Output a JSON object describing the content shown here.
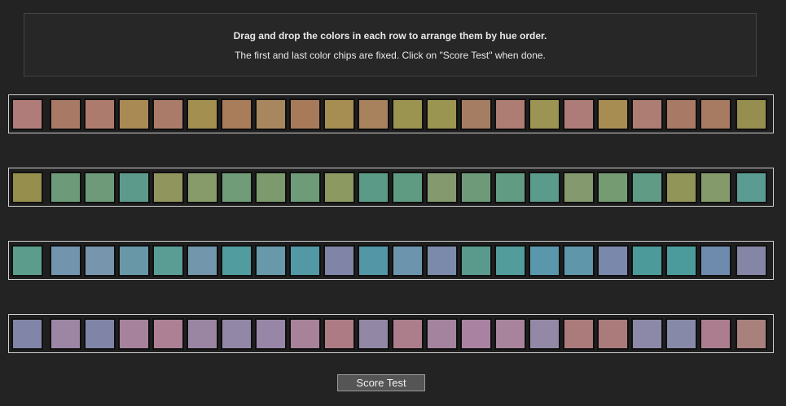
{
  "instructions": {
    "line1": "Drag and drop the colors in each row to arrange them by hue order.",
    "line2": "The first and last color chips are fixed. Click on \"Score Test\" when done."
  },
  "rows": [
    {
      "chips": [
        "#b07c7a",
        "#a87a66",
        "#ad7b6d",
        "#a98a55",
        "#ab7b69",
        "#a39050",
        "#a97c5a",
        "#a9875e",
        "#a77b5a",
        "#a68d52",
        "#a7825c",
        "#9b9450",
        "#9a9550",
        "#a57d62",
        "#ad7c72",
        "#9b9452",
        "#ae7c78",
        "#a88d52",
        "#ad7c72",
        "#a87965",
        "#a67b62",
        "#958e4e"
      ]
    },
    {
      "chips": [
        "#968e4d",
        "#6d9b79",
        "#6f9a79",
        "#5c9b8c",
        "#90955e",
        "#879a69",
        "#709c78",
        "#7c9a6d",
        "#6f9c78",
        "#8c9960",
        "#5c9a88",
        "#5f9a83",
        "#849a6e",
        "#6e9a79",
        "#629b84",
        "#5a9b8c",
        "#84996d",
        "#759b73",
        "#609b85",
        "#929558",
        "#859a6b",
        "#5a9b92"
      ]
    },
    {
      "chips": [
        "#5c9c8d",
        "#7394ad",
        "#7796ae",
        "#6898a8",
        "#5a9d94",
        "#7296ab",
        "#519c9e",
        "#6799aa",
        "#5398a5",
        "#8085a7",
        "#5396a6",
        "#6c95ad",
        "#7b8aaa",
        "#5a9a8c",
        "#529c9c",
        "#5b97ac",
        "#6096a9",
        "#7a88ab",
        "#4c9a99",
        "#4c9b9c",
        "#6e8bad",
        "#8585a6"
      ]
    },
    {
      "chips": [
        "#8186a9",
        "#9c86a3",
        "#8085a8",
        "#a7829c",
        "#ad8094",
        "#9a86a2",
        "#9287a6",
        "#9786a6",
        "#a78299",
        "#ac7b84",
        "#9288a6",
        "#ac7d8a",
        "#a4839f",
        "#a882a0",
        "#a8849c",
        "#9389a6",
        "#ab7a7b",
        "#ab7b7b",
        "#8c89a8",
        "#8789a9",
        "#ab7d8f",
        "#a8807c"
      ]
    }
  ],
  "score_button": {
    "label": "Score Test"
  }
}
